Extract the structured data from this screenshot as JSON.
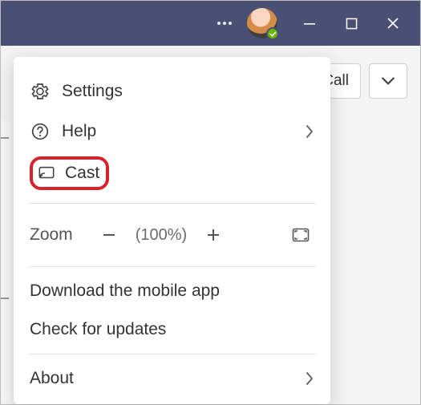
{
  "titlebar": {},
  "toolbar": {
    "call_label": "Call"
  },
  "menu": {
    "settings": "Settings",
    "help": "Help",
    "cast": "Cast",
    "zoom_label": "Zoom",
    "zoom_pct": "(100%)",
    "download": "Download the mobile app",
    "updates": "Check for updates",
    "about": "About"
  },
  "colors": {
    "titlebar": "#4a4f74",
    "highlight": "#d8232a"
  }
}
